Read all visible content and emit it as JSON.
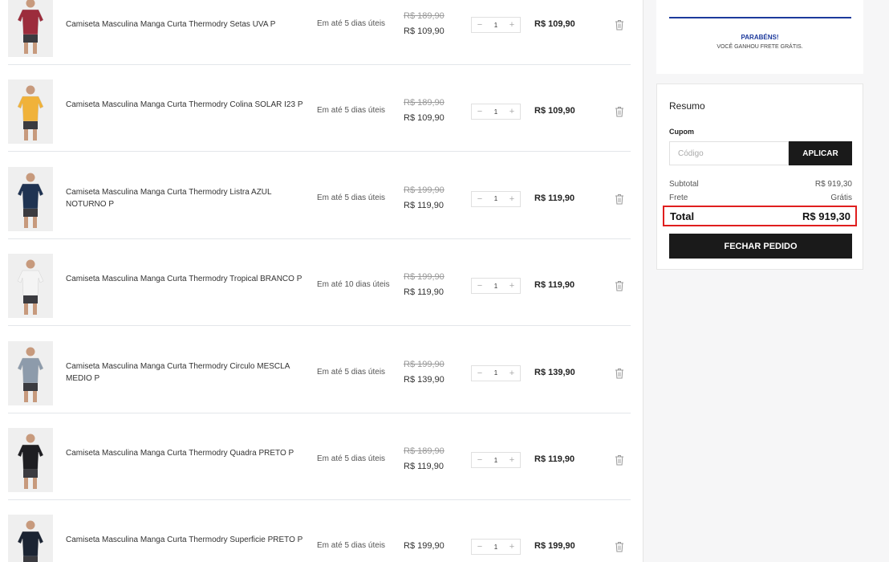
{
  "cart": {
    "items": [
      {
        "name": "Camiseta Masculina Manga Curta Thermodry Setas UVA P",
        "shipping": "Em até 5 dias úteis",
        "old_price": "R$ 189,90",
        "price": "R$ 109,90",
        "qty": "1",
        "total": "R$ 109,90",
        "shirt_color": "#9c2c3c"
      },
      {
        "name": "Camiseta Masculina Manga Curta Thermodry Colina SOLAR I23 P",
        "shipping": "Em até 5 dias úteis",
        "old_price": "R$ 189,90",
        "price": "R$ 109,90",
        "qty": "1",
        "total": "R$ 109,90",
        "shirt_color": "#f0b23a"
      },
      {
        "name": "Camiseta Masculina Manga Curta Thermodry Listra AZUL NOTURNO P",
        "shipping": "Em até 5 dias úteis",
        "old_price": "R$ 199,90",
        "price": "R$ 119,90",
        "qty": "1",
        "total": "R$ 119,90",
        "shirt_color": "#1f3352"
      },
      {
        "name": "Camiseta Masculina Manga Curta Thermodry Tropical BRANCO P",
        "shipping": "Em até 10 dias úteis",
        "old_price": "R$ 199,90",
        "price": "R$ 119,90",
        "qty": "1",
        "total": "R$ 119,90",
        "shirt_color": "#f4f4f4"
      },
      {
        "name": "Camiseta Masculina Manga Curta Thermodry Circulo MESCLA MEDIO P",
        "shipping": "Em até 5 dias úteis",
        "old_price": "R$ 199,90",
        "price": "R$ 139,90",
        "qty": "1",
        "total": "R$ 139,90",
        "shirt_color": "#8d9bab"
      },
      {
        "name": "Camiseta Masculina Manga Curta Thermodry Quadra PRETO P",
        "shipping": "Em até 5 dias úteis",
        "old_price": "R$ 189,90",
        "price": "R$ 119,90",
        "qty": "1",
        "total": "R$ 119,90",
        "shirt_color": "#1e1e22"
      },
      {
        "name": "Camiseta Masculina Manga Curta Thermodry Superficie PRETO P",
        "shipping": "Em até 5 dias úteis",
        "old_price": "",
        "price": "R$ 199,90",
        "qty": "1",
        "total": "R$ 199,90",
        "shirt_color": "#1b2433"
      }
    ],
    "minus_symbol": "−",
    "plus_symbol": "+"
  },
  "freight": {
    "title": "PARABÉNS!",
    "message": "VOCÊ GANHOU FRETE GRÁTIS.",
    "accent": "#1d3a9c"
  },
  "summary": {
    "title": "Resumo",
    "coupon_label": "Cupom",
    "coupon_placeholder": "Código",
    "coupon_value": "",
    "apply_label": "APLICAR",
    "subtotal_label": "Subtotal",
    "subtotal_value": "R$ 919,30",
    "shipping_label": "Frete",
    "shipping_value": "Grátis",
    "total_label": "Total",
    "total_value": "R$ 919,30",
    "checkout_label": "FECHAR PEDIDO",
    "highlight_color": "#e01e1e"
  },
  "icons": {
    "delete": "trash-icon",
    "product": "product-photo"
  }
}
